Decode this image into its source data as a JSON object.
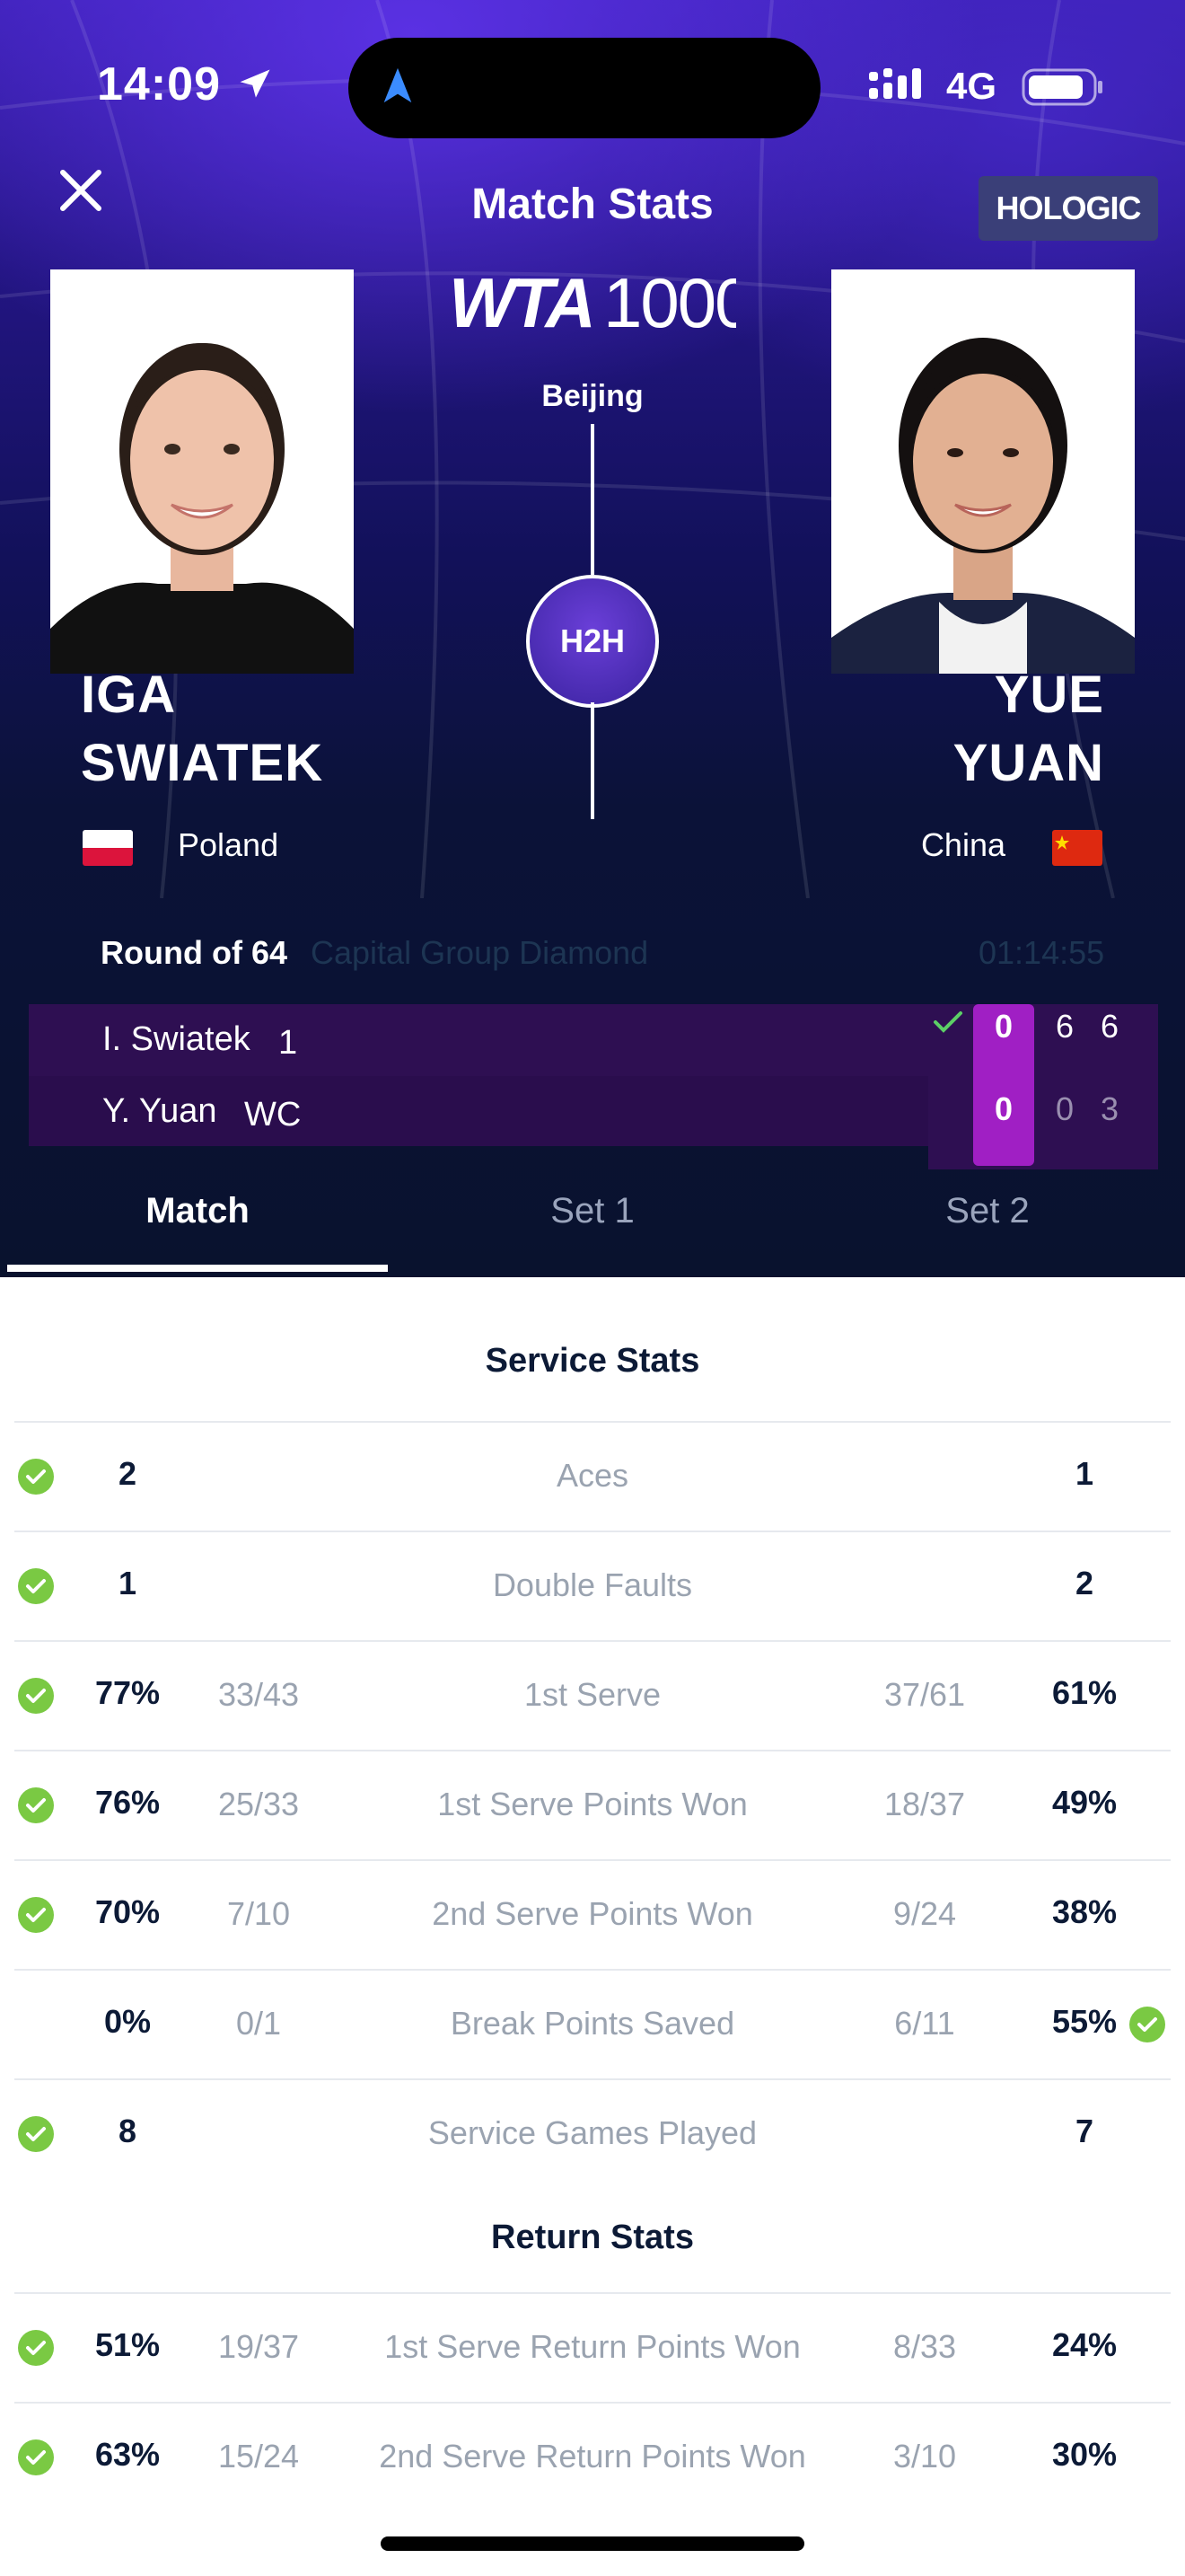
{
  "status": {
    "time": "14:09",
    "network": "4G"
  },
  "header": {
    "title": "Match Stats",
    "sponsor": "HOLOGIC",
    "tour_logo": "WTA 1000",
    "city": "Beijing",
    "h2h_label": "H2H"
  },
  "players": {
    "left": {
      "first": "IGA",
      "last": "SWIATEK",
      "country": "Poland"
    },
    "right": {
      "first": "YUE",
      "last": "YUAN",
      "country": "China"
    }
  },
  "match": {
    "round": "Round of 64",
    "tournament": "Capital Group Diamond",
    "duration": "01:14:55"
  },
  "score": {
    "rows": [
      {
        "name": "I. Swiatek",
        "seed": "1",
        "current": "0",
        "sets": [
          "6",
          "6"
        ]
      },
      {
        "name": "Y. Yuan",
        "seed": "WC",
        "current": "0",
        "sets": [
          "0",
          "3"
        ]
      }
    ]
  },
  "tabs": [
    "Match",
    "Set 1",
    "Set 2"
  ],
  "service_stats": {
    "title": "Service Stats",
    "rows": [
      {
        "label": "Aces",
        "left": "2",
        "left_frac": "",
        "right": "1",
        "right_frac": "",
        "winner": "left"
      },
      {
        "label": "Double Faults",
        "left": "1",
        "left_frac": "",
        "right": "2",
        "right_frac": "",
        "winner": "left"
      },
      {
        "label": "1st Serve",
        "left": "77%",
        "left_frac": "33/43",
        "right": "61%",
        "right_frac": "37/61",
        "winner": "left"
      },
      {
        "label": "1st Serve Points Won",
        "left": "76%",
        "left_frac": "25/33",
        "right": "49%",
        "right_frac": "18/37",
        "winner": "left"
      },
      {
        "label": "2nd Serve Points Won",
        "left": "70%",
        "left_frac": "7/10",
        "right": "38%",
        "right_frac": "9/24",
        "winner": "left"
      },
      {
        "label": "Break Points Saved",
        "left": "0%",
        "left_frac": "0/1",
        "right": "55%",
        "right_frac": "6/11",
        "winner": "right"
      },
      {
        "label": "Service Games Played",
        "left": "8",
        "left_frac": "",
        "right": "7",
        "right_frac": "",
        "winner": "left"
      }
    ]
  },
  "return_stats": {
    "title": "Return Stats",
    "rows": [
      {
        "label": "1st Serve Return Points Won",
        "left": "51%",
        "left_frac": "19/37",
        "right": "24%",
        "right_frac": "8/33",
        "winner": "left"
      },
      {
        "label": "2nd Serve Return Points Won",
        "left": "63%",
        "left_frac": "15/24",
        "right": "30%",
        "right_frac": "3/10",
        "winner": "left"
      }
    ]
  },
  "colors": {
    "accent_purple": "#a01fc4",
    "winner_green": "#7ac943",
    "dark_text": "#0c1a36",
    "muted_text": "#9aa3b0"
  }
}
